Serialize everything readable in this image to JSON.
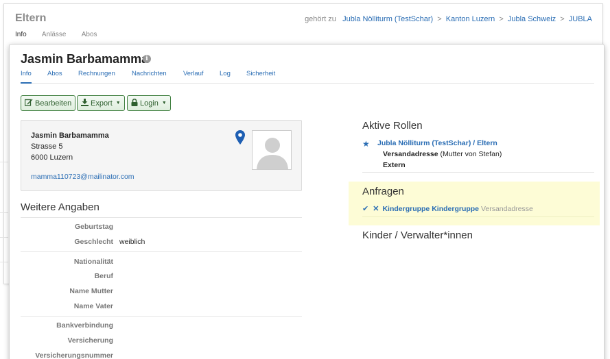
{
  "background": {
    "title": "Eltern",
    "breadcrumb_prefix": "gehört zu",
    "breadcrumbs": [
      "Jubla Nölliturm (TestSchar)",
      "Kanton Luzern",
      "Jubla Schweiz",
      "JUBLA"
    ],
    "separator": ">",
    "tabs": [
      "Info",
      "Anlässe",
      "Abos"
    ]
  },
  "person": {
    "title": "Jasmin Barbamamma",
    "info_icon": "i",
    "tabs": [
      "Info",
      "Abos",
      "Rechnungen",
      "Nachrichten",
      "Verlauf",
      "Log",
      "Sicherheit"
    ],
    "active_tab": "Info"
  },
  "toolbar": {
    "edit_label": "Bearbeiten",
    "export_label": "Export",
    "login_label": "Login"
  },
  "contact": {
    "name": "Jasmin Barbamamma",
    "street": "Strasse 5",
    "city": "6000 Luzern",
    "email": "mamma110723@mailinator.com"
  },
  "details": {
    "heading": "Weitere Angaben",
    "group1": [
      {
        "label": "Geburtstag",
        "value": ""
      },
      {
        "label": "Geschlecht",
        "value": "weiblich"
      }
    ],
    "group2": [
      {
        "label": "Nationalität",
        "value": ""
      },
      {
        "label": "Beruf",
        "value": ""
      },
      {
        "label": "Name Mutter",
        "value": ""
      },
      {
        "label": "Name Vater",
        "value": ""
      }
    ],
    "group3": [
      {
        "label": "Bankverbindung",
        "value": ""
      },
      {
        "label": "Versicherung",
        "value": ""
      },
      {
        "label": "Versicherungsnummer",
        "value": ""
      }
    ]
  },
  "roles": {
    "heading": "Aktive Rollen",
    "group_link": "Jubla Nölliturm (TestSchar)",
    "role_sep": "/",
    "role_link": "Eltern",
    "line1_bold": "Versandadresse",
    "line1_rest": "(Mutter von Stefan)",
    "line2_bold": "Extern"
  },
  "requests": {
    "heading": "Anfragen",
    "group": "Kindergruppe Kindergruppe",
    "type": "Versandadresse"
  },
  "children": {
    "heading": "Kinder / Verwalter*innen"
  },
  "colors": {
    "link": "#2a6db4",
    "button_border": "#3f7f3f",
    "request_bg": "#fdfcd6"
  }
}
